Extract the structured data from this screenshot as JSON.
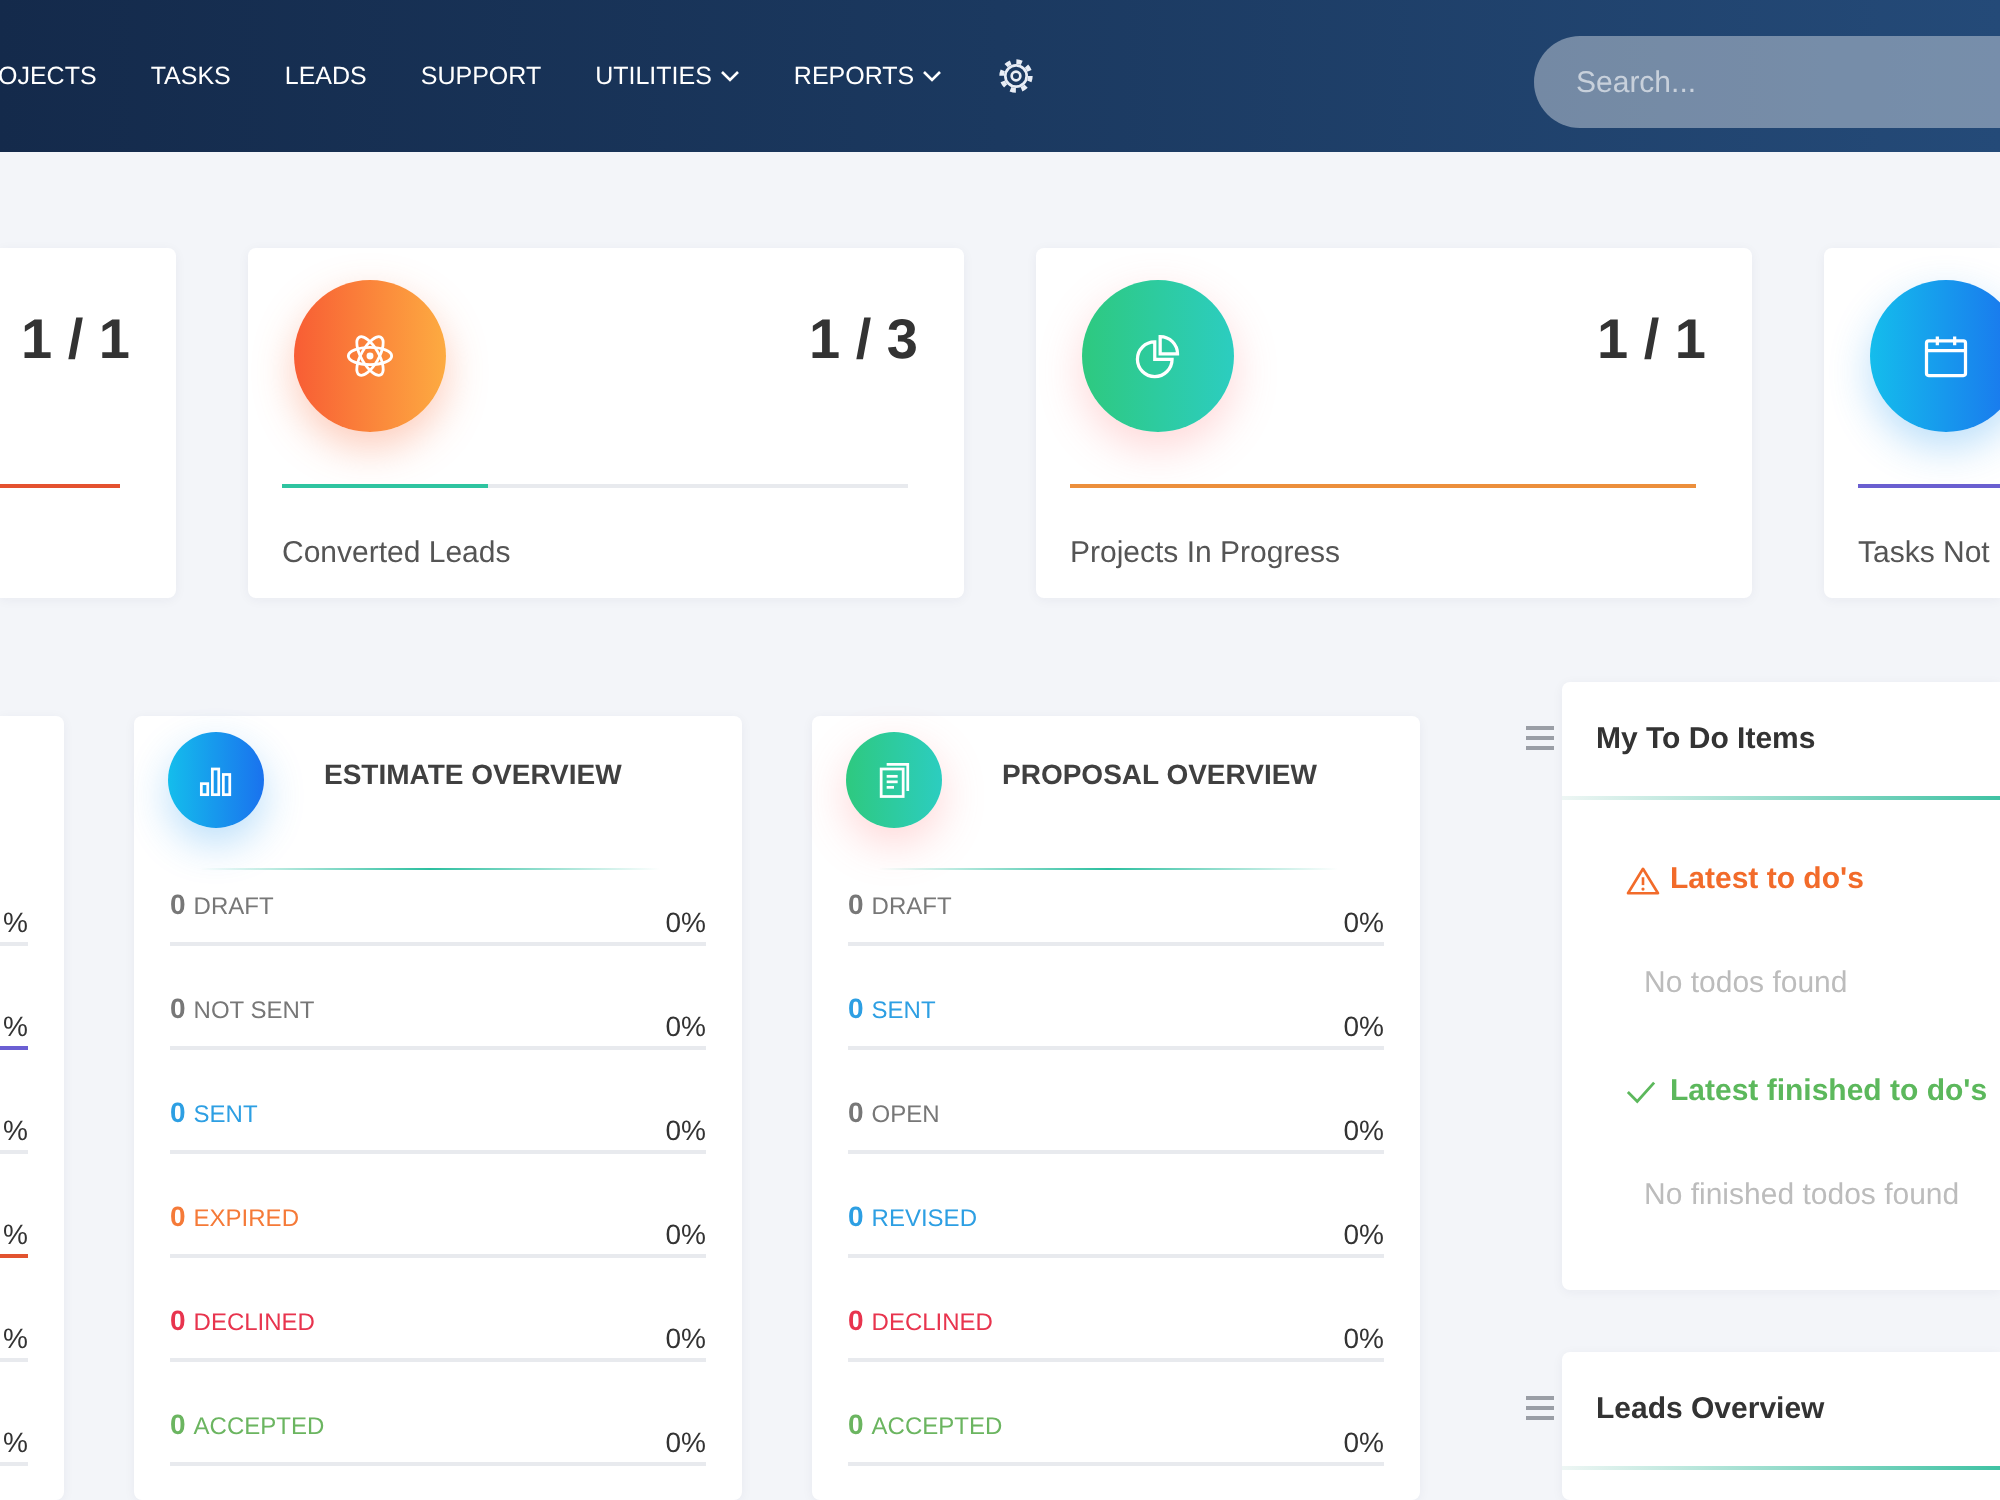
{
  "nav": {
    "items": [
      {
        "label": "OJECTS",
        "has_menu": false
      },
      {
        "label": "TASKS",
        "has_menu": false
      },
      {
        "label": "LEADS",
        "has_menu": false
      },
      {
        "label": "SUPPORT",
        "has_menu": false
      },
      {
        "label": "UTILITIES",
        "has_menu": true
      },
      {
        "label": "REPORTS",
        "has_menu": true
      }
    ],
    "search": {
      "placeholder": "Search..."
    }
  },
  "stat_cards": [
    {
      "value": "1 / 1",
      "level": 1,
      "color": "#e4512f"
    },
    {
      "value": "1 / 3",
      "level": 0.33,
      "color": "#2ec4a0",
      "label": "Converted Leads"
    },
    {
      "value": "1 / 1",
      "level": 1,
      "color": "#ec8f3c",
      "label": "Projects In Progress"
    },
    {
      "level": 1,
      "color": "#6a5fd0",
      "label": "Tasks Not"
    }
  ],
  "overviews": [
    {
      "rows": [
        {
          "percent": "%",
          "level": 0
        },
        {
          "percent": "%",
          "level": 1,
          "color": "#6b5fd3"
        },
        {
          "percent": "%",
          "level": 0
        },
        {
          "percent": "%",
          "level": 1,
          "color": "#e2532f"
        },
        {
          "percent": "%",
          "level": 0
        },
        {
          "percent": "%",
          "level": 0
        }
      ]
    },
    {
      "title": "ESTIMATE OVERVIEW",
      "rows": [
        {
          "count": "0",
          "label": "DRAFT",
          "percent": "0%",
          "level": 0,
          "color": "#777777"
        },
        {
          "count": "0",
          "label": "NOT SENT",
          "percent": "0%",
          "level": 0,
          "color": "#777777"
        },
        {
          "count": "0",
          "label": "SENT",
          "percent": "0%",
          "level": 0,
          "color": "#2d9fe3"
        },
        {
          "count": "0",
          "label": "EXPIRED",
          "percent": "0%",
          "level": 0,
          "color": "#f57a38"
        },
        {
          "count": "0",
          "label": "DECLINED",
          "percent": "0%",
          "level": 0,
          "color": "#e8344e"
        },
        {
          "count": "0",
          "label": "ACCEPTED",
          "percent": "0%",
          "level": 0,
          "color": "#6bb560"
        }
      ]
    },
    {
      "title": "PROPOSAL OVERVIEW",
      "rows": [
        {
          "count": "0",
          "label": "DRAFT",
          "percent": "0%",
          "level": 0,
          "color": "#777777"
        },
        {
          "count": "0",
          "label": "SENT",
          "percent": "0%",
          "level": 0,
          "color": "#2d9fe3"
        },
        {
          "count": "0",
          "label": "OPEN",
          "percent": "0%",
          "level": 0,
          "color": "#777777"
        },
        {
          "count": "0",
          "label": "REVISED",
          "percent": "0%",
          "level": 0,
          "color": "#2d9fe3"
        },
        {
          "count": "0",
          "label": "DECLINED",
          "percent": "0%",
          "level": 0,
          "color": "#e8344e"
        },
        {
          "count": "0",
          "label": "ACCEPTED",
          "percent": "0%",
          "level": 0,
          "color": "#6bb560"
        }
      ]
    }
  ],
  "widgets": [
    {
      "title": "My To Do Items",
      "sections": [
        {
          "kind": "pending",
          "heading": "Latest to do's",
          "empty_text": "No todos found"
        },
        {
          "kind": "finished",
          "heading": "Latest finished to do's",
          "empty_text": "No finished todos found"
        }
      ]
    },
    {
      "title": "Leads Overview"
    }
  ]
}
